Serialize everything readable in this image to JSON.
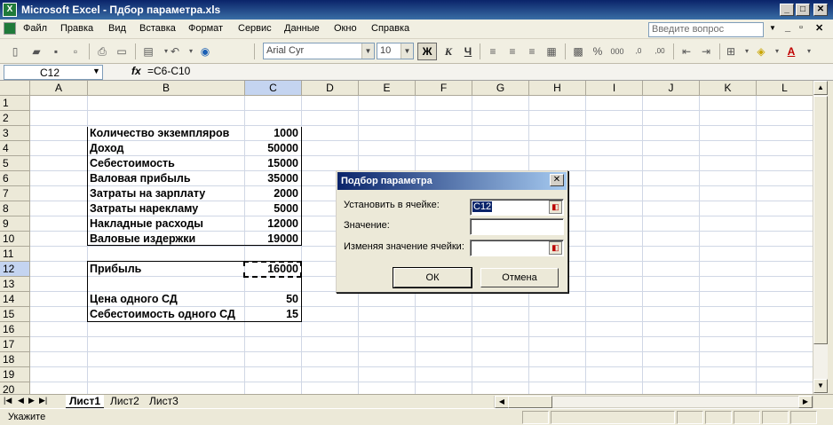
{
  "window": {
    "title": "Microsoft Excel - Пдбор параметра.xls",
    "controls": [
      "_",
      "□",
      "✕"
    ]
  },
  "menu": {
    "items": [
      "Файл",
      "Правка",
      "Вид",
      "Вставка",
      "Формат",
      "Сервис",
      "Данные",
      "Окно",
      "Справка"
    ],
    "help_placeholder": "Введите вопрос",
    "doc_controls": [
      "_",
      "▫",
      "✕"
    ]
  },
  "toolbar": {
    "font": "Arial Cyr",
    "size": "10",
    "bold": "Ж",
    "italic": "К",
    "underline": "Ч",
    "percent": "%",
    "thousands": "000",
    "inc_decimal": ",0",
    "dec_decimal": ",00"
  },
  "formula_bar": {
    "name_box": "C12",
    "fx": "fx",
    "formula": "=C6-C10"
  },
  "grid": {
    "columns": [
      "A",
      "B",
      "C",
      "D",
      "E",
      "F",
      "G",
      "H",
      "I",
      "J",
      "K",
      "L"
    ],
    "selected_column": "C",
    "rows": [
      "1",
      "2",
      "3",
      "4",
      "5",
      "6",
      "7",
      "8",
      "9",
      "10",
      "11",
      "12",
      "13",
      "14",
      "15",
      "16",
      "17",
      "18",
      "19",
      "20"
    ],
    "selected_row": "12",
    "cells": [
      {
        "row": 3,
        "label": "Количество экземпляров",
        "value": "1000"
      },
      {
        "row": 4,
        "label": "Доход",
        "value": "50000"
      },
      {
        "row": 5,
        "label": "Себестоимость",
        "value": "15000"
      },
      {
        "row": 6,
        "label": "Валовая прибыль",
        "value": "35000"
      },
      {
        "row": 7,
        "label": "Затраты на зарплату",
        "value": "2000"
      },
      {
        "row": 8,
        "label": "Затраты нарекламу",
        "value": "5000"
      },
      {
        "row": 9,
        "label": "Накладные расходы",
        "value": "12000"
      },
      {
        "row": 10,
        "label": "Валовые издержки",
        "value": "19000"
      },
      {
        "row": 12,
        "label": "Прибыль",
        "value": "16000"
      },
      {
        "row": 14,
        "label": "Цена одного СД",
        "value": "50"
      },
      {
        "row": 15,
        "label": "Себестоимость одного СД",
        "value": "15"
      }
    ]
  },
  "dialog": {
    "title": "Подбор параметра",
    "set_cell_label": "Установить в ячейке:",
    "set_cell_value": "C12",
    "to_value_label": "Значение:",
    "to_value_value": "",
    "changing_cell_label": "Изменяя значение ячейки:",
    "changing_cell_value": "",
    "ok": "ОК",
    "cancel": "Отмена"
  },
  "sheets": {
    "tabs": [
      "Лист1",
      "Лист2",
      "Лист3"
    ],
    "active": "Лист1"
  },
  "status": {
    "text": "Укажите"
  }
}
